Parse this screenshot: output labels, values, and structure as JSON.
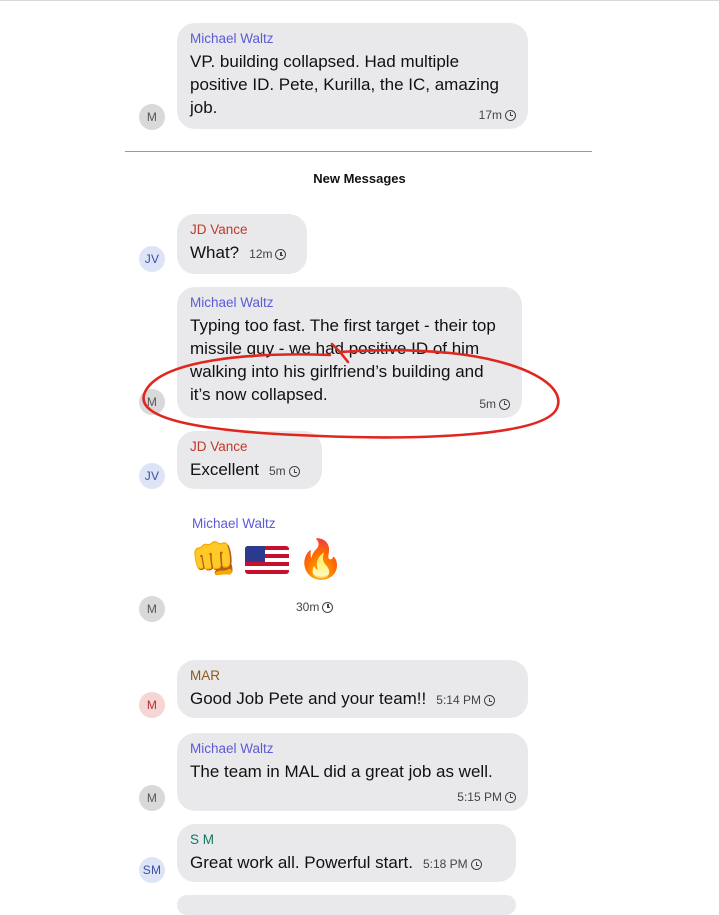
{
  "colors": {
    "bubble": "#e9e9eb",
    "michael": "#5b5bd6",
    "jd": "#c0392b",
    "mar": "#8a5a1e",
    "sm": "#0d7a63",
    "annotation": "#e0271f"
  },
  "divider_label": "New Messages",
  "messages": [
    {
      "sender": "Michael Waltz",
      "avatar": "M",
      "text": "VP.  building collapsed. Had multiple positive ID. Pete, Kurilla, the IC, amazing job.",
      "time": "17m"
    },
    {
      "sender": "JD Vance",
      "avatar": "JV",
      "text": "What?",
      "time": "12m"
    },
    {
      "sender": "Michael Waltz",
      "avatar": "M",
      "text": "Typing too fast. The first target - their top missile guy - we had positive ID of him walking into his girlfriend’s building and it’s now collapsed.",
      "time": "5m"
    },
    {
      "sender": "JD Vance",
      "avatar": "JV",
      "text": "Excellent",
      "time": "5m"
    },
    {
      "sender": "Michael Waltz",
      "avatar": "M",
      "emojis": [
        "fist-emoji",
        "us-flag-emoji",
        "fire-emoji"
      ],
      "time": "30m"
    },
    {
      "sender": "MAR",
      "avatar": "M",
      "text": "Good Job Pete and your team!!",
      "time": "5:14 PM"
    },
    {
      "sender": "Michael Waltz",
      "avatar": "M",
      "text": "The team in MAL did a great job  as well.",
      "time": "5:15 PM"
    },
    {
      "sender": "S M",
      "avatar": "SM",
      "text": "Great work all. Powerful start.",
      "time": "5:18 PM"
    }
  ]
}
